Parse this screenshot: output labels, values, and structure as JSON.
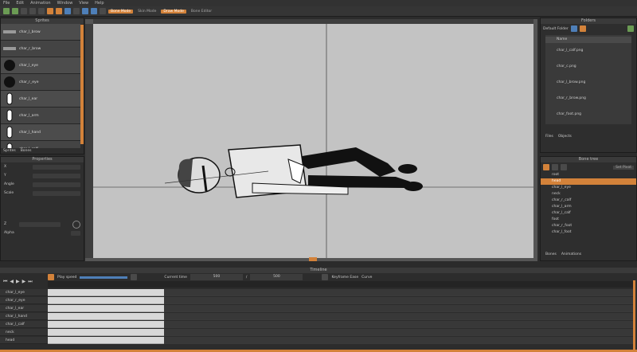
{
  "menu": [
    "File",
    "Edit",
    "Animation",
    "Window",
    "View",
    "Help"
  ],
  "toolbar": {
    "mode_buttons": [
      "Bone Mode",
      "Skin Mode",
      "Draw Mode",
      "Bone Editor"
    ],
    "active": "Draw Mode"
  },
  "sprites_panel": {
    "title": "Sprites",
    "items": [
      "char_l_brow",
      "char_r_brow",
      "char_l_eye",
      "char_r_eye",
      "char_l_ear",
      "char_l_arm",
      "char_l_hand",
      "char_l_calf"
    ],
    "tabs": [
      "Sprites",
      "Bones"
    ]
  },
  "props_panel": {
    "title": "Properties",
    "rows": [
      "X",
      "Y",
      "Angle",
      "Scale",
      "Alpha"
    ],
    "label_z": "Z",
    "label_opacity": "Alpha"
  },
  "canvas": {
    "bg": "#c3c3c3"
  },
  "right_panel": {
    "title": "Folders",
    "default_folder_label": "Default Folder",
    "tree": [
      "Name",
      "char_l_calf.png",
      "char_c.png",
      "char_l_brow.png",
      "char_r_brow.png",
      "char_foot.png"
    ],
    "tabs": [
      "Files",
      "Objects"
    ]
  },
  "bones_panel": {
    "title": "Bone tree",
    "button": "Set Pivot",
    "items": [
      "root",
      "head",
      "char_l_eye",
      "neck",
      "char_r_calf",
      "char_l_arm",
      "char_l_calf",
      "foot",
      "char_r_foot",
      "char_l_foot"
    ],
    "tabs": [
      "Bones",
      "Animations"
    ]
  },
  "timeline": {
    "title": "Timeline",
    "label_speed": "Play speed",
    "label_current": "Current time",
    "current_time": "500",
    "total_time": "500",
    "label_interp": "Keyframe Ease",
    "label_curve": "Curve",
    "tracks": [
      "char_l_eye",
      "char_r_eye",
      "char_l_ear",
      "char_l_hand",
      "char_l_calf",
      "neck",
      "head"
    ]
  },
  "colors": {
    "accent": "#d3823a",
    "panel": "#2e2e2e"
  }
}
